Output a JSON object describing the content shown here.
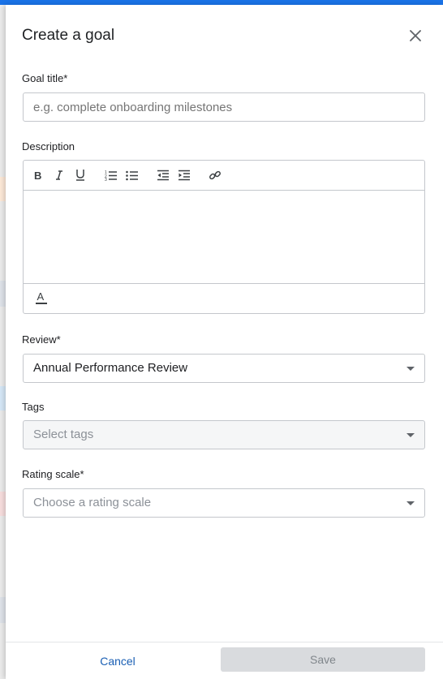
{
  "dialog": {
    "title": "Create a goal",
    "close_icon": "close-icon"
  },
  "goal_title": {
    "label": "Goal title*",
    "placeholder": "e.g. complete onboarding milestones",
    "value": ""
  },
  "description": {
    "label": "Description",
    "toolbar": [
      "bold-icon",
      "italic-icon",
      "underline-icon",
      "ordered-list-icon",
      "bullet-list-icon",
      "outdent-icon",
      "indent-icon",
      "link-icon"
    ],
    "bottom_toolbar": [
      "text-color-icon"
    ],
    "value": ""
  },
  "review": {
    "label": "Review*",
    "value": "Annual Performance Review"
  },
  "tags": {
    "label": "Tags",
    "placeholder": "Select tags"
  },
  "rating_scale": {
    "label": "Rating scale*",
    "placeholder": "Choose a rating scale"
  },
  "footer": {
    "cancel_label": "Cancel",
    "save_label": "Save"
  },
  "colors": {
    "accent": "#1a73e8",
    "link": "#1a5fb4",
    "disabled_button": "#d9dbde"
  }
}
